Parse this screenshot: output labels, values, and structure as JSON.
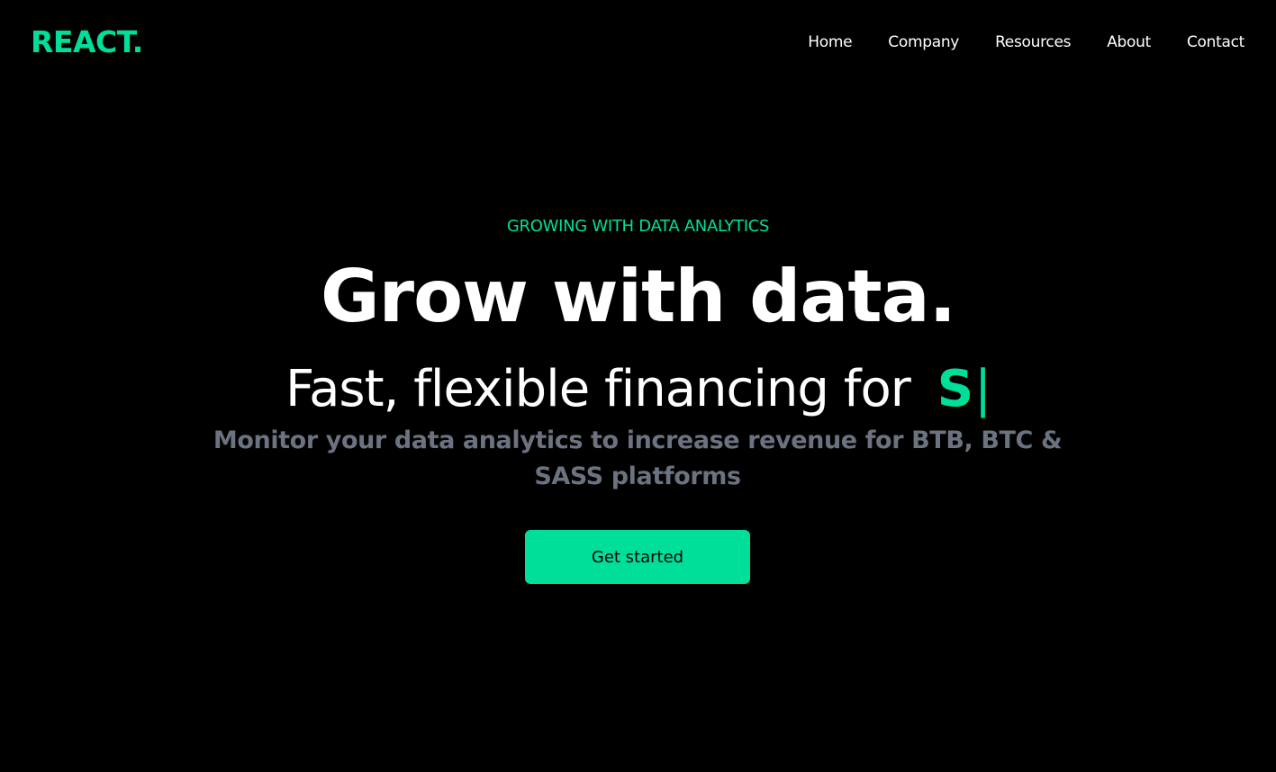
{
  "colors": {
    "accent": "#00df9a",
    "background": "#000000",
    "text": "#ffffff",
    "muted": "#6b7280"
  },
  "navbar": {
    "logo": "REACT.",
    "items": [
      {
        "label": "Home"
      },
      {
        "label": "Company"
      },
      {
        "label": "Resources"
      },
      {
        "label": "About"
      },
      {
        "label": "Contact"
      }
    ]
  },
  "hero": {
    "eyebrow": "GROWING WITH DATA ANALYTICS",
    "headline": "Grow with data.",
    "typed_prefix": "Fast, flexible financing for",
    "typed_word": "S",
    "typed_cursor": "|",
    "subtext": "Monitor your data analytics to increase revenue for BTB, BTC & SASS platforms",
    "cta_label": "Get started"
  }
}
